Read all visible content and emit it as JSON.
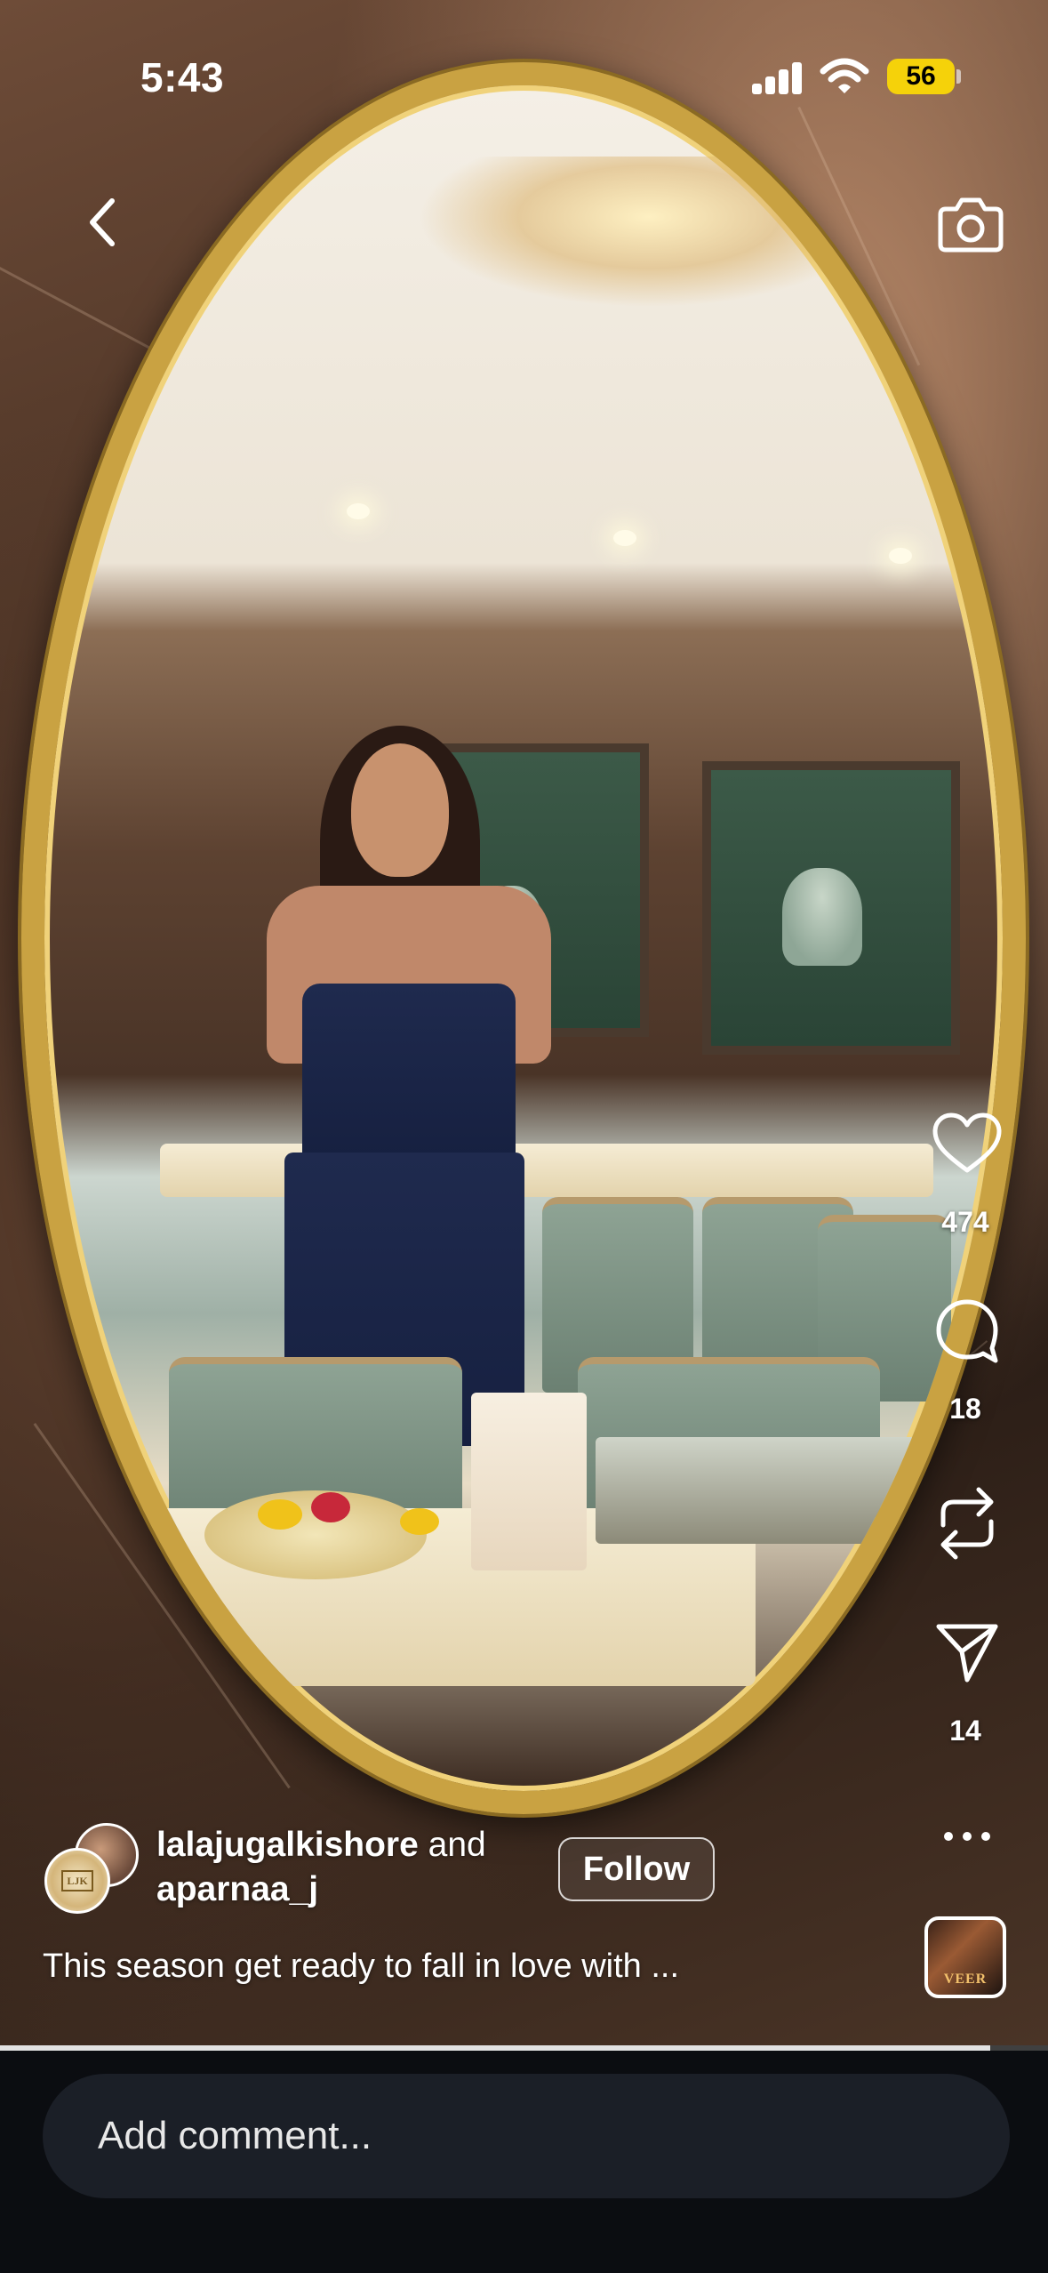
{
  "status_bar": {
    "time": "5:43",
    "battery": "56",
    "battery_color": "#f5d20a"
  },
  "top_bar": {
    "back_icon": "chevron-left-icon",
    "camera_icon": "camera-icon"
  },
  "actions": {
    "like_icon": "heart-icon",
    "like_count": "474",
    "comment_icon": "comment-bubble-icon",
    "comment_count": "18",
    "repost_icon": "repost-icon",
    "share_icon": "send-icon",
    "share_count": "14",
    "more_icon": "more-horizontal-icon"
  },
  "post": {
    "author_primary": "lalajugalkishore",
    "conjunction": "and",
    "author_secondary": "aparnaa_j",
    "follow_label": "Follow",
    "caption": "This season get ready to fall in love with ...",
    "audio_label": "VEER"
  },
  "playback": {
    "progress": 0.945
  },
  "comment": {
    "placeholder": "Add comment..."
  }
}
